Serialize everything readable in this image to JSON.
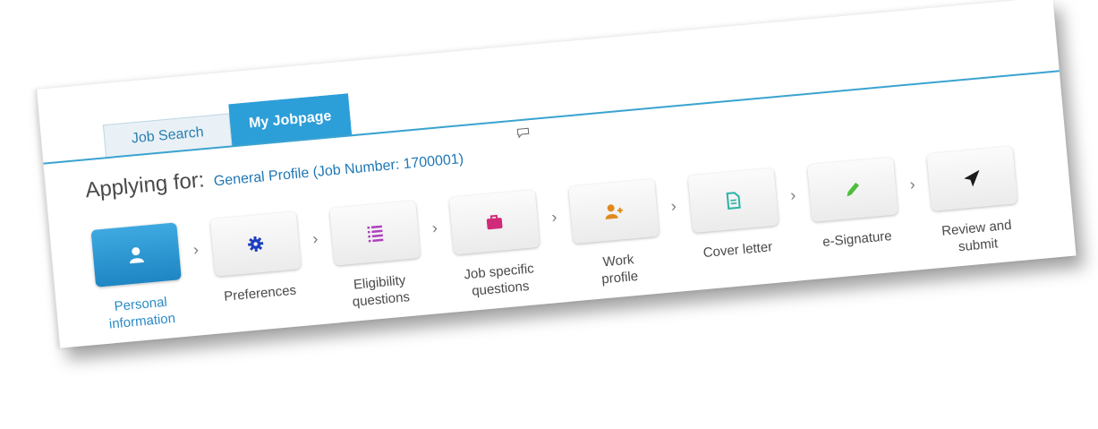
{
  "tabs": [
    {
      "label": "Job Search",
      "active": false
    },
    {
      "label": "My Jobpage",
      "active": true
    }
  ],
  "applying": {
    "label": "Applying for:",
    "link": "General Profile (Job Number: 1700001)"
  },
  "steps": [
    {
      "label": "Personal\ninformation",
      "icon": "person-icon",
      "icon_color": "#ffffff",
      "active": true
    },
    {
      "label": "Preferences",
      "icon": "gear-icon",
      "icon_color": "#1f3fbf",
      "active": false
    },
    {
      "label": "Eligibility\nquestions",
      "icon": "list-icon",
      "icon_color": "#b03fbf",
      "active": false
    },
    {
      "label": "Job specific\nquestions",
      "icon": "briefcase-icon",
      "icon_color": "#d12a7a",
      "active": false
    },
    {
      "label": "Work\nprofile",
      "icon": "add-user-icon",
      "icon_color": "#e08a1e",
      "active": false
    },
    {
      "label": "Cover letter",
      "icon": "document-icon",
      "icon_color": "#2ab3a6",
      "active": false
    },
    {
      "label": "e-Signature",
      "icon": "pencil-icon",
      "icon_color": "#4cbf3a",
      "active": false
    },
    {
      "label": "Review and\nsubmit",
      "icon": "send-icon",
      "icon_color": "#1a1a1a",
      "active": false
    }
  ],
  "separator_glyph": "›",
  "colors": {
    "accent": "#2c9ed8",
    "link": "#1f77b4",
    "text": "#4a4a4a"
  }
}
